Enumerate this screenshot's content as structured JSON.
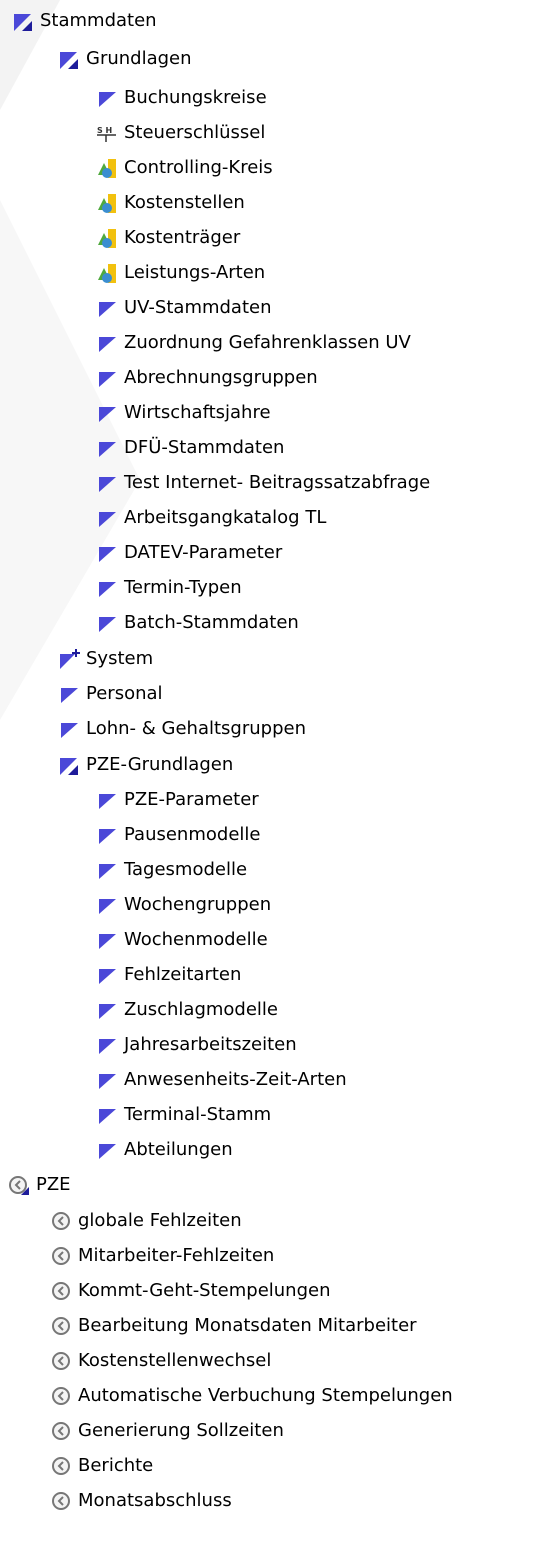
{
  "icons": {
    "folder_open": "folder-open-icon",
    "folder": "folder-icon",
    "folder_new": "folder-star-icon",
    "key": "tax-key-icon",
    "controlling": "controlling-icon",
    "clock": "clock-icon"
  },
  "colors": {
    "folder": "#4b48d8",
    "folder_dark": "#1e1c9a",
    "clock": "#777777"
  },
  "tree": {
    "stammdaten": "Stammdaten",
    "grundlagen": "Grundlagen",
    "grundlagen_items": [
      "Buchungskreise",
      "Steuerschlüssel",
      "Controlling-Kreis",
      "Kostenstellen",
      "Kostenträger",
      "Leistungs-Arten",
      "UV-Stammdaten",
      "Zuordnung Gefahrenklassen UV",
      "Abrechnungsgruppen",
      "Wirtschaftsjahre",
      "DFÜ-Stammdaten",
      "Test Internet- Beitragssatzabfrage",
      "Arbeitsgangkatalog TL",
      "DATEV-Parameter",
      "Termin-Typen",
      "Batch-Stammdaten"
    ],
    "system": "System",
    "personal": "Personal",
    "lohn": "Lohn- & Gehaltsgruppen",
    "pze_grundlagen": "PZE-Grundlagen",
    "pze_grundlagen_items": [
      "PZE-Parameter",
      "Pausenmodelle",
      "Tagesmodelle",
      "Wochengruppen",
      "Wochenmodelle",
      "Fehlzeitarten",
      "Zuschlagmodelle",
      "Jahresarbeitszeiten",
      "Anwesenheits-Zeit-Arten",
      "Terminal-Stamm",
      "Abteilungen"
    ],
    "pze": "PZE",
    "pze_items": [
      "globale Fehlzeiten",
      "Mitarbeiter-Fehlzeiten",
      "Kommt-Geht-Stempelungen",
      "Bearbeitung Monatsdaten Mitarbeiter",
      "Kostenstellenwechsel",
      "Automatische Verbuchung Stempelungen",
      "Generierung Sollzeiten",
      "Berichte",
      "Monatsabschluss"
    ]
  }
}
